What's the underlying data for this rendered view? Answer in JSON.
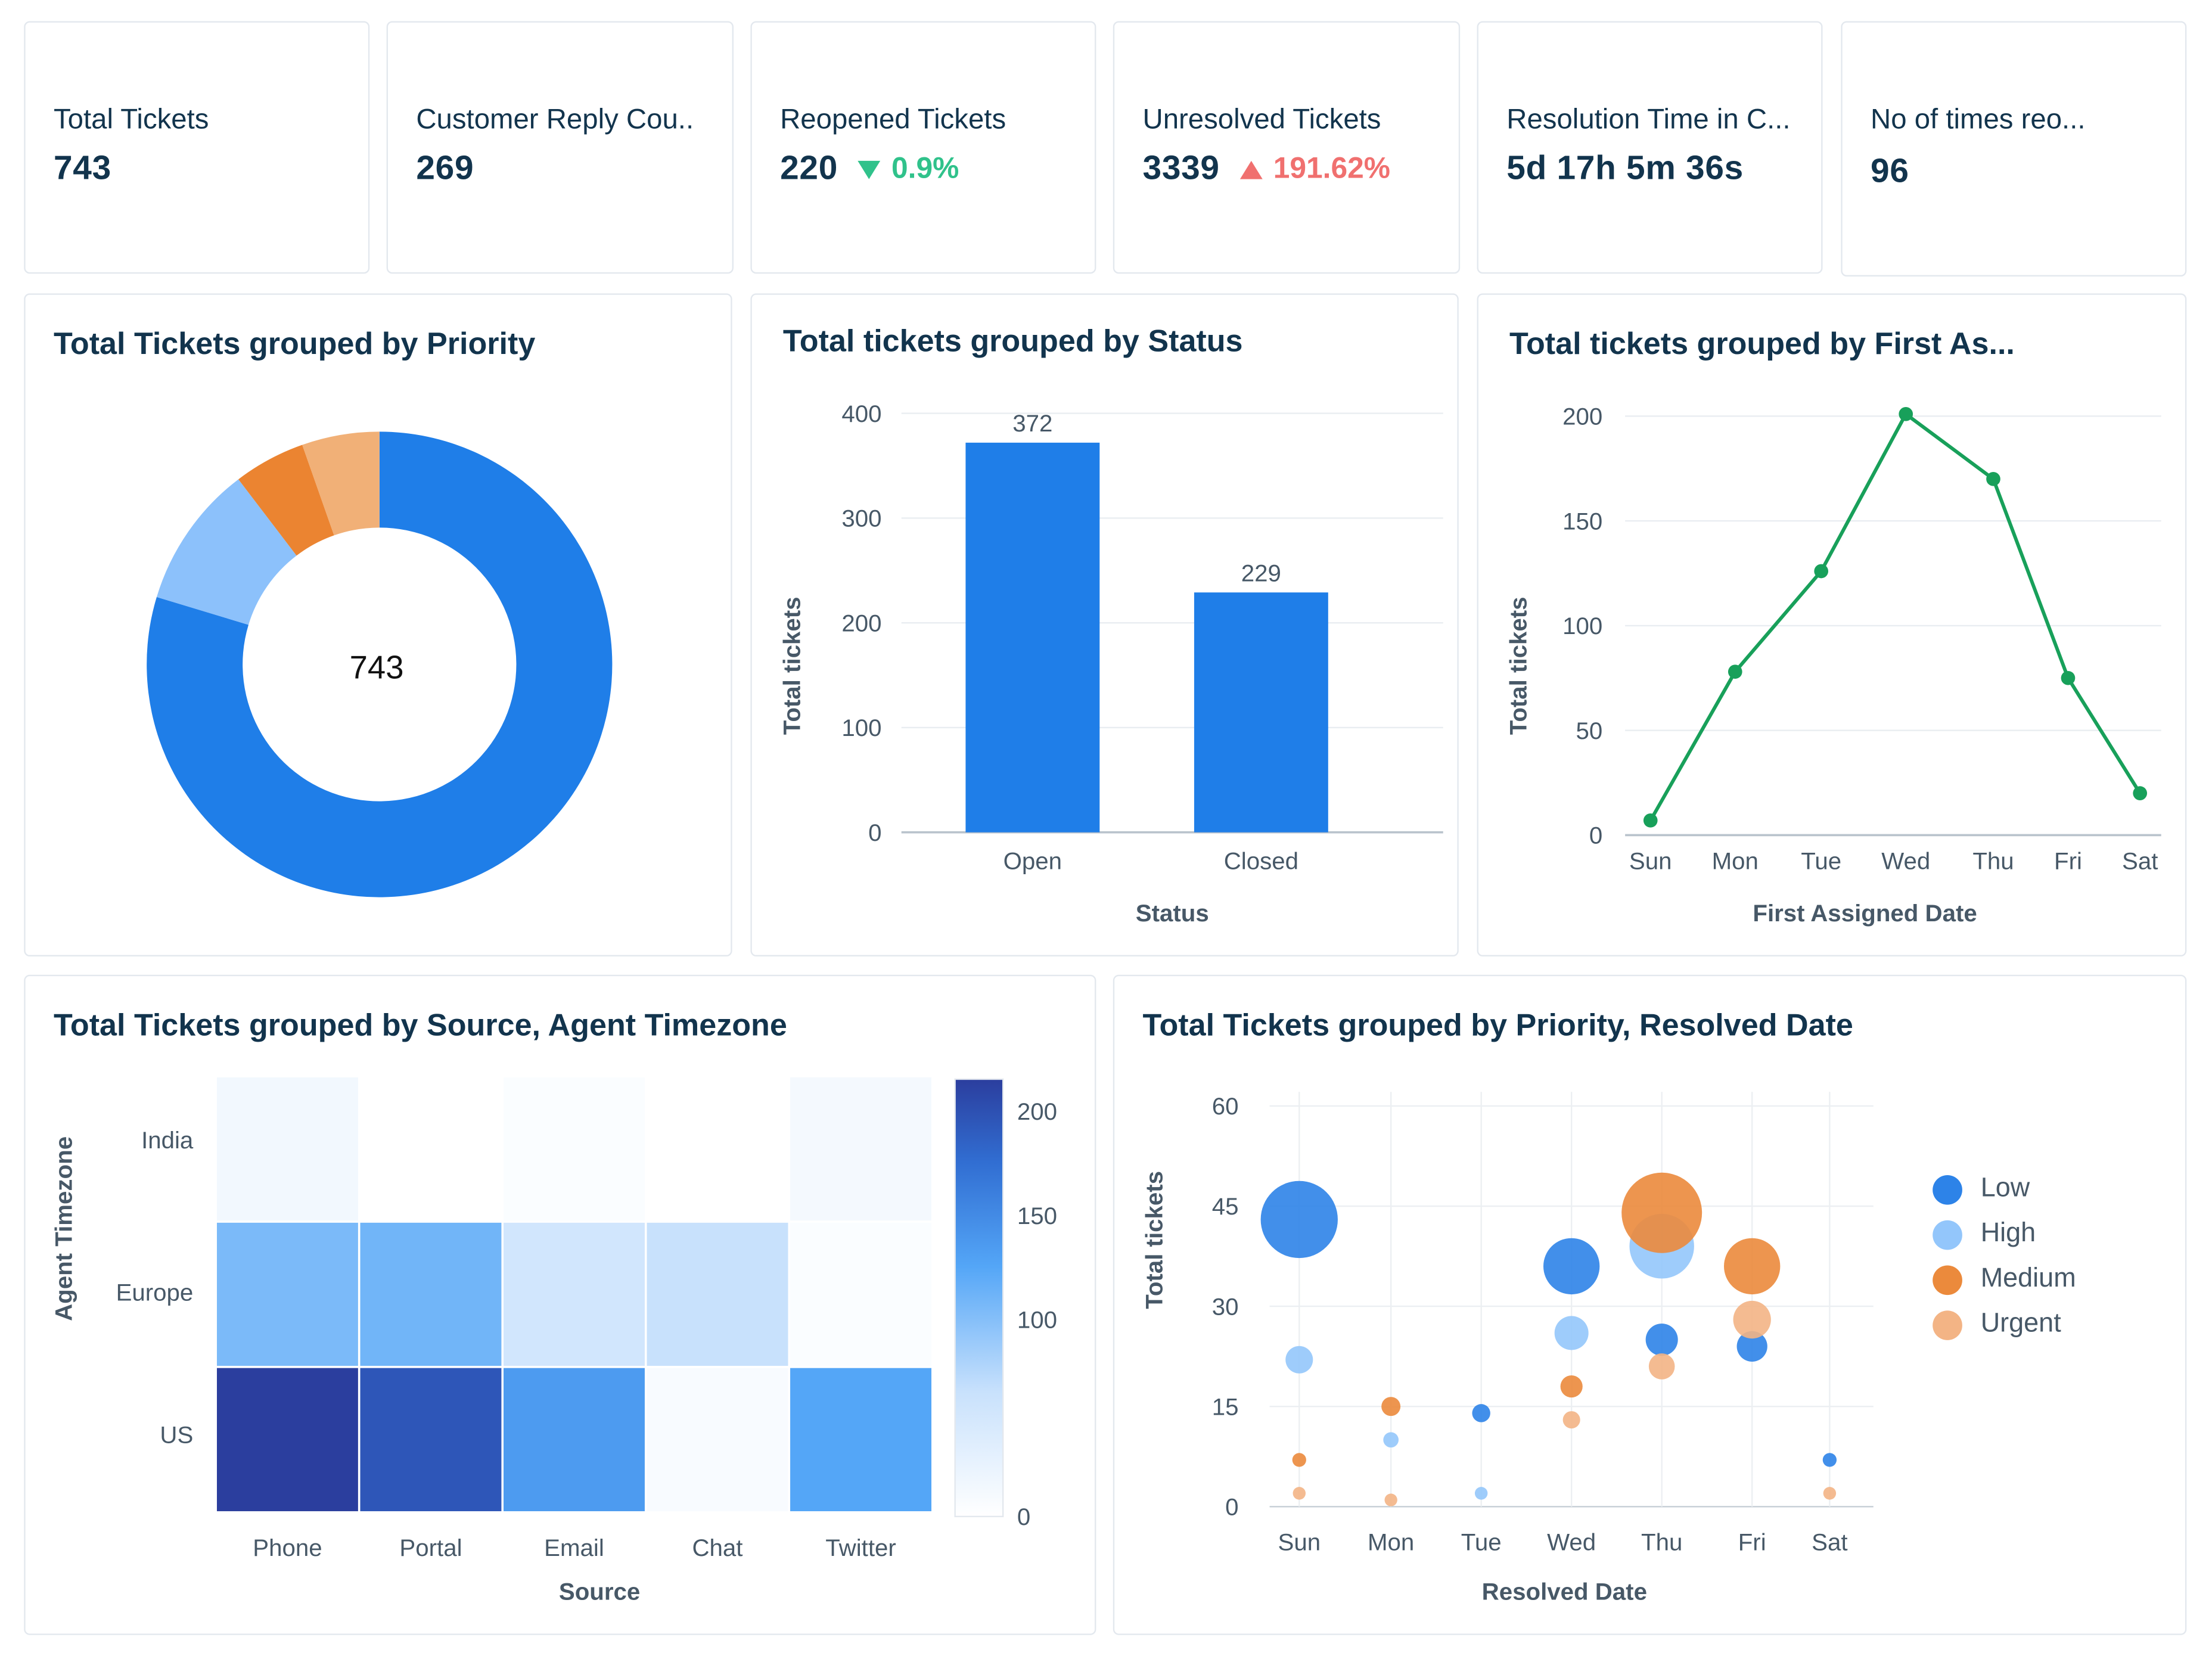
{
  "kpis": [
    {
      "label": "Total Tickets",
      "value": "743"
    },
    {
      "label": "Customer Reply Cou..",
      "value": "269"
    },
    {
      "label": "Reopened Tickets",
      "value": "220",
      "change": "0.9%",
      "direction": "down"
    },
    {
      "label": "Unresolved Tickets",
      "value": "3339",
      "change": "191.62%",
      "direction": "up"
    },
    {
      "label": "Resolution Time in C...",
      "value": "5d 17h 5m 36s"
    },
    {
      "label": "No of times reo...",
      "value": "96"
    }
  ],
  "colors": {
    "primary_blue": "#1f7ee8",
    "light_blue": "#8cc1fb",
    "orange": "#eb8431",
    "light_orange": "#f1b077",
    "green": "#18a05a",
    "down": "#30c28b",
    "up": "#f0706f"
  },
  "chart_data": [
    {
      "type": "pie",
      "title": "Total Tickets grouped by Priority",
      "center_label": "743",
      "slices": [
        {
          "name": "Low",
          "value": 592,
          "color": "#1f7ee8"
        },
        {
          "name": "High",
          "value": 74,
          "color": "#8cc1fb"
        },
        {
          "name": "Medium",
          "value": 37,
          "color": "#eb8431"
        },
        {
          "name": "Urgent",
          "value": 40,
          "color": "#f1b077"
        }
      ]
    },
    {
      "type": "bar",
      "title": "Total tickets grouped by Status",
      "categories": [
        "Open",
        "Closed"
      ],
      "values": [
        372,
        229
      ],
      "xlabel": "Status",
      "ylabel": "Total tickets",
      "ylim": [
        0,
        400
      ],
      "yticks": [
        0,
        100,
        200,
        300,
        400
      ],
      "grid": true
    },
    {
      "type": "line",
      "title": "Total tickets grouped by First As...",
      "x": [
        "Sun",
        "Mon",
        "Tue",
        "Wed",
        "Thu",
        "Fri",
        "Sat"
      ],
      "values": [
        7,
        78,
        126,
        201,
        170,
        75,
        20
      ],
      "xlabel": "First Assigned Date",
      "ylabel": "Total tickets",
      "ylim": [
        0,
        200
      ],
      "yticks": [
        0,
        50,
        100,
        150,
        200
      ],
      "grid": true
    },
    {
      "type": "heatmap",
      "title": "Total Tickets grouped by Source, Agent Timezone",
      "x": [
        "Phone",
        "Portal",
        "Email",
        "Chat",
        "Twitter"
      ],
      "y": [
        "India",
        "Europe",
        "US"
      ],
      "values": [
        [
          14,
          0,
          5,
          0,
          12
        ],
        [
          100,
          105,
          50,
          60,
          5
        ],
        [
          210,
          190,
          130,
          8,
          120
        ]
      ],
      "xlabel": "Source",
      "ylabel": "Agent Timezone",
      "scale_ticks": [
        0,
        100,
        150,
        200
      ],
      "scale_range": [
        0,
        210
      ]
    },
    {
      "type": "scatter",
      "title": "Total Tickets grouped by Priority, Resolved Date",
      "x": [
        "Sun",
        "Mon",
        "Tue",
        "Wed",
        "Thu",
        "Fri",
        "Sat"
      ],
      "xlabel": "Resolved Date",
      "ylabel": "Total tickets",
      "ylim": [
        0,
        60
      ],
      "yticks": [
        0,
        15,
        30,
        45,
        60
      ],
      "legend_position": "right",
      "grid": true,
      "series": [
        {
          "name": "Low",
          "color": "#2d83e8",
          "points": [
            {
              "x": "Sun",
              "y": 43
            },
            {
              "x": "Tue",
              "y": 14
            },
            {
              "x": "Wed",
              "y": 36
            },
            {
              "x": "Thu",
              "y": 25
            },
            {
              "x": "Fri",
              "y": 24
            },
            {
              "x": "Sat",
              "y": 7
            }
          ]
        },
        {
          "name": "High",
          "color": "#93c6fb",
          "points": [
            {
              "x": "Sun",
              "y": 22
            },
            {
              "x": "Mon",
              "y": 10
            },
            {
              "x": "Tue",
              "y": 2
            },
            {
              "x": "Wed",
              "y": 26
            },
            {
              "x": "Thu",
              "y": 39
            }
          ]
        },
        {
          "name": "Medium",
          "color": "#eb8a3c",
          "points": [
            {
              "x": "Sun",
              "y": 7
            },
            {
              "x": "Mon",
              "y": 15
            },
            {
              "x": "Wed",
              "y": 18
            },
            {
              "x": "Thu",
              "y": 44
            },
            {
              "x": "Fri",
              "y": 36
            }
          ]
        },
        {
          "name": "Urgent",
          "color": "#f3b485",
          "points": [
            {
              "x": "Sun",
              "y": 2
            },
            {
              "x": "Mon",
              "y": 1
            },
            {
              "x": "Wed",
              "y": 13
            },
            {
              "x": "Thu",
              "y": 21
            },
            {
              "x": "Fri",
              "y": 28
            },
            {
              "x": "Sat",
              "y": 2
            }
          ]
        }
      ]
    }
  ]
}
